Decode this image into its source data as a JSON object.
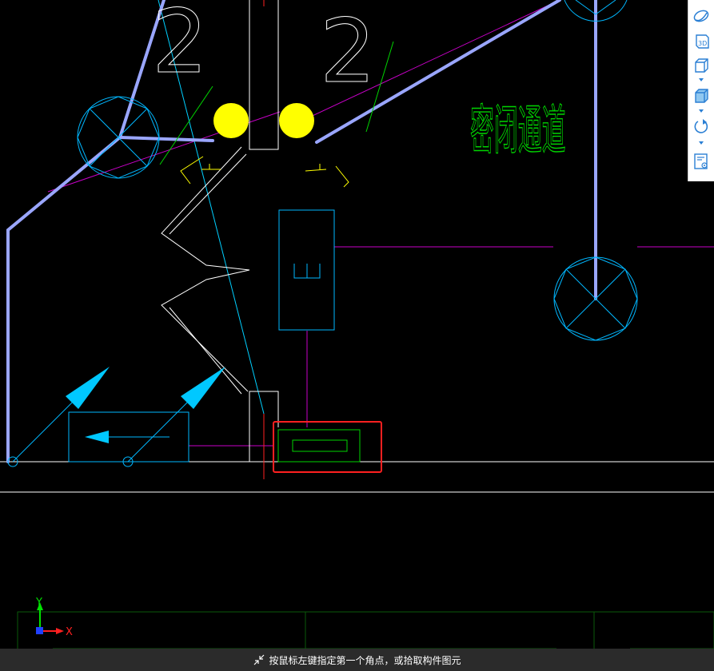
{
  "app": {
    "status_message": "按鼠标左键指定第一个角点，或拾取构件图元"
  },
  "drawing": {
    "text_labels": {
      "number_left": "2",
      "number_mid": "2",
      "room_name": "密闭通道"
    },
    "colors": {
      "background": "#000000",
      "white_line": "#ffffff",
      "cyan": "#00b7ff",
      "magenta": "#c800c8",
      "yellow": "#ffff00",
      "green": "#00d400",
      "beam": "#9aa6ff",
      "selection_box": "#ff2020",
      "axis_y": "#00e000",
      "axis_x": "#ff2020"
    }
  },
  "ucs": {
    "y_label": "Y",
    "x_label": "X"
  },
  "toolbar": {
    "items": [
      {
        "name": "orbit-icon"
      },
      {
        "name": "view-3d-icon",
        "label": "3D"
      },
      {
        "name": "box-view-icon"
      },
      {
        "name": "box-view-shaded-icon"
      },
      {
        "name": "rotate-icon"
      },
      {
        "name": "display-settings-icon"
      }
    ]
  }
}
